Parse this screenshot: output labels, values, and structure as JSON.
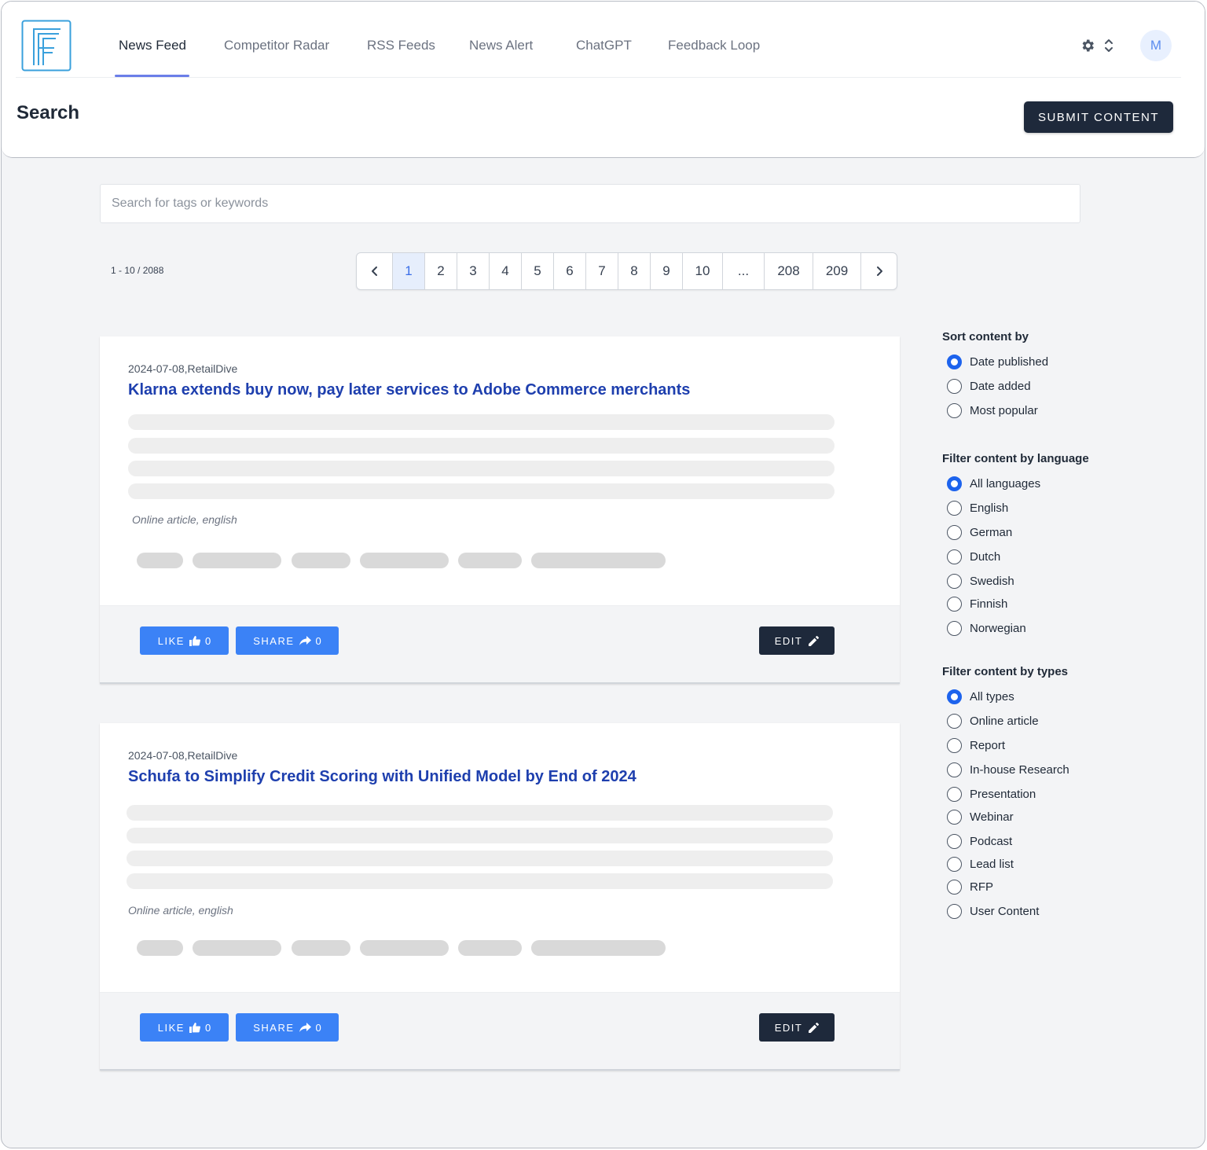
{
  "nav": {
    "tabs": [
      {
        "label": "News Feed",
        "active": true
      },
      {
        "label": "Competitor Radar",
        "active": false
      },
      {
        "label": "RSS Feeds",
        "active": false
      },
      {
        "label": "News Alert",
        "active": false
      },
      {
        "label": "ChatGPT",
        "active": false
      },
      {
        "label": "Feedback Loop",
        "active": false
      }
    ],
    "avatar_initial": "M",
    "accent_color": "#6b7ee8"
  },
  "header": {
    "page_title": "Search",
    "submit_label": "SUBMIT CONTENT"
  },
  "search": {
    "placeholder": "Search for tags or keywords",
    "value": ""
  },
  "results": {
    "count_text": "1 - 10 / 2088"
  },
  "pagination": {
    "pages": [
      "1",
      "2",
      "3",
      "4",
      "5",
      "6",
      "7",
      "8",
      "9",
      "10",
      "...",
      "208",
      "209"
    ],
    "current": "1"
  },
  "articles": [
    {
      "meta": "2024-07-08,RetailDive",
      "title": "Klarna extends buy now, pay later services to Adobe Commerce merchants",
      "type": "Online article, english",
      "like_label": "LIKE",
      "like_count": "0",
      "share_label": "SHARE",
      "share_count": "0",
      "edit_label": "EDIT"
    },
    {
      "meta": "2024-07-08,RetailDive",
      "title": "Schufa to Simplify Credit Scoring with Unified Model by End of 2024",
      "type": "Online article, english",
      "like_label": "LIKE",
      "like_count": "0",
      "share_label": "SHARE",
      "share_count": "0",
      "edit_label": "EDIT"
    }
  ],
  "sidebar": {
    "sort": {
      "title": "Sort content by",
      "options": [
        "Date published",
        "Date added",
        "Most popular"
      ],
      "selected": 0
    },
    "language": {
      "title": "Filter content by language",
      "options": [
        "All languages",
        "English",
        "German",
        "Dutch",
        "Swedish",
        "Finnish",
        "Norwegian"
      ],
      "selected": 0
    },
    "types": {
      "title": "Filter content by types",
      "options": [
        "All types",
        "Online article",
        "Report",
        "In-house Research",
        "Presentation",
        "Webinar",
        "Podcast",
        "Lead list",
        "RFP",
        "User Content"
      ],
      "selected": 0
    }
  },
  "colors": {
    "primary_dark": "#1e293b",
    "like_blue": "#3b82f6",
    "title_blue": "#1e3fae",
    "radio_blue": "#1d63ed"
  }
}
